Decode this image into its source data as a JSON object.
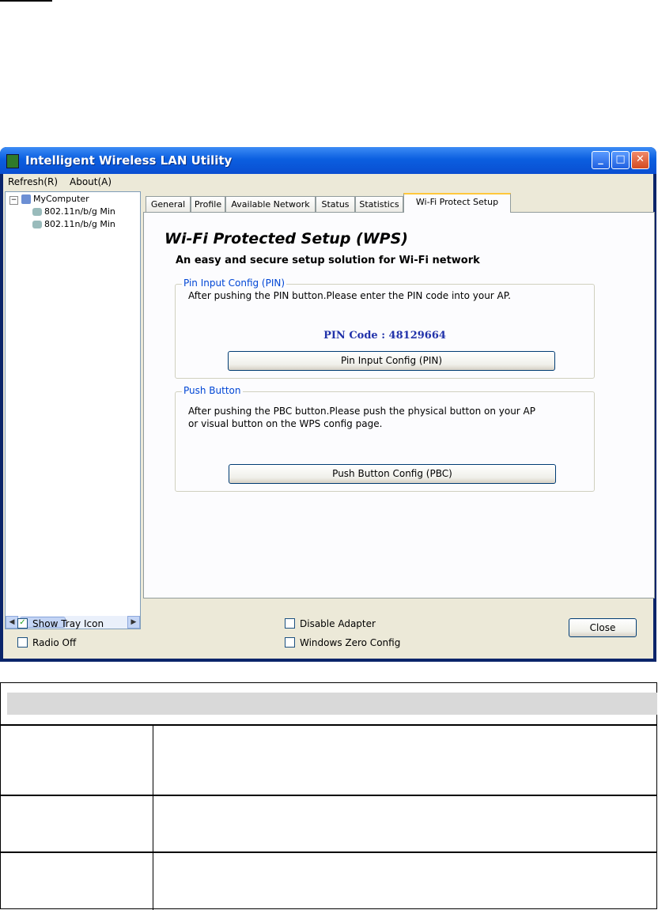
{
  "window": {
    "title": "Intelligent Wireless LAN Utility",
    "controls": {
      "minimize": "_",
      "maximize": "□",
      "close": "✕"
    }
  },
  "menu": {
    "refresh": "Refresh(R)",
    "about": "About(A)"
  },
  "tree": {
    "root": "MyComputer",
    "items": [
      "802.11n/b/g Min",
      "802.11n/b/g Min"
    ]
  },
  "tabs": [
    "General",
    "Profile",
    "Available Network",
    "Status",
    "Statistics",
    "Wi-Fi Protect Setup"
  ],
  "active_tab": "Wi-Fi Protect Setup",
  "wps": {
    "heading": "Wi-Fi Protected Setup (WPS)",
    "subheading": "An easy and secure setup solution for Wi-Fi network",
    "pin_group": {
      "label": "Pin Input Config (PIN)",
      "text": "After pushing the PIN button.Please enter the PIN code into your AP.",
      "pin_code": "PIN Code :  48129664",
      "button": "Pin Input Config (PIN)"
    },
    "pbc_group": {
      "label": "Push Button",
      "text_line1": "After pushing the PBC button.Please push the physical button on your AP",
      "text_line2": "or visual button on the WPS config page.",
      "button": "Push Button Config (PBC)"
    }
  },
  "options": {
    "show_tray_icon": {
      "label": "Show Tray Icon",
      "checked": true
    },
    "radio_off": {
      "label": "Radio Off",
      "checked": false
    },
    "disable_adapter": {
      "label": "Disable Adapter",
      "checked": false
    },
    "windows_zero_config": {
      "label": "Windows Zero Config",
      "checked": false
    }
  },
  "close_button": "Close"
}
